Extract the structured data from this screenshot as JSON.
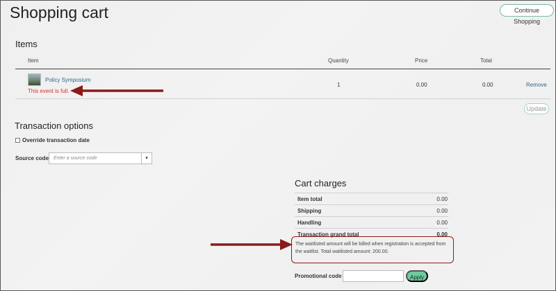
{
  "page": {
    "title": "Shopping cart",
    "continue_label": "Continue Shopping"
  },
  "items": {
    "title": "Items",
    "headers": {
      "item": "Item",
      "quantity": "Quantity",
      "price": "Price",
      "total": "Total"
    },
    "rows": [
      {
        "name": "Policy Symposium",
        "message": "This event is full.",
        "quantity": "1",
        "price": "0.00",
        "total": "0.00",
        "remove_label": "Remove"
      }
    ],
    "update_label": "Update"
  },
  "transaction_options": {
    "title": "Transaction options",
    "override_label": "Override transaction date",
    "override_checked": false,
    "source_code_label": "Source code",
    "source_code_placeholder": "Enter a source code",
    "source_code_value": ""
  },
  "cart_charges": {
    "title": "Cart charges",
    "rows": [
      {
        "label": "Item total",
        "value": "0.00"
      },
      {
        "label": "Shipping",
        "value": "0.00"
      },
      {
        "label": "Handling",
        "value": "0.00"
      },
      {
        "label": "Transaction grand total",
        "value": "0.00"
      }
    ],
    "waitlist_note": "The waitlisted amount will be billed when registration is accepted from the waitlist. Total waitlisted amount: 200.00."
  },
  "promo": {
    "label": "Promotional code",
    "value": "",
    "apply_label": "Apply"
  },
  "colors": {
    "accent": "#6dcc9e",
    "error": "#d9302c",
    "link": "#2a6a8a",
    "annotation": "#8b1a1a"
  },
  "icons": {
    "dropdown": "caret-down-icon",
    "arrows": "annotation-arrow-icon"
  }
}
